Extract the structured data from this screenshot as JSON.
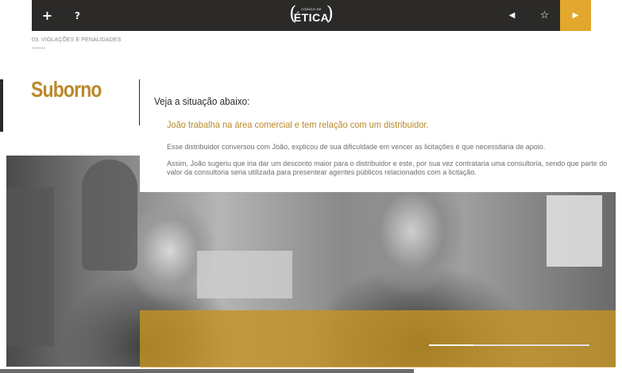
{
  "header": {
    "menu_icon": "+",
    "help_icon": "?",
    "logo_small": "CÓDIGO DE",
    "logo_big": "ÉTICA",
    "paren_left": "(",
    "paren_right": ")",
    "prev_icon": "◀",
    "star_icon": "☆",
    "next_icon": "▶",
    "accent_color": "#e2a72c",
    "bar_color": "#2b2a28"
  },
  "breadcrumb": "03. VIOLAÇÕES E PENALIDADES",
  "page_title": "Suborno",
  "content": {
    "intro": "Veja a situação abaixo:",
    "highlight": "João trabalha na área comercial e tem relação com um distribuidor.",
    "paragraphs": [
      "Esse distribuidor conversou com João, explicou de sua dificuldade em vencer as licitações e que necessitaria de apoio.",
      "Assim, João sugeriu que iria dar um desconto maior para o distribuidor e este, por sua vez contrataria uma consultoria, sendo que parte do valor da consultoria seria utilizada para presentear agentes públicos relacionados com a licitação."
    ]
  },
  "progress": {
    "fraction": 0.665
  }
}
